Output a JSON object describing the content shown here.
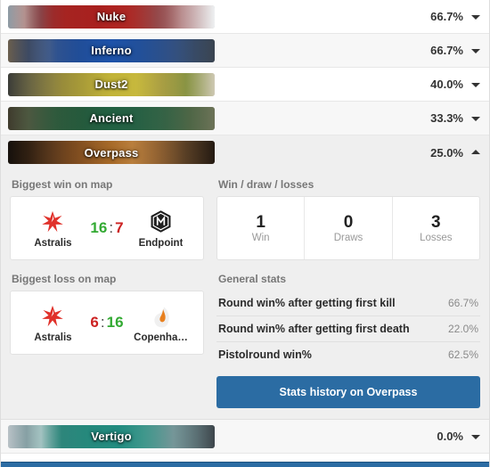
{
  "maps": [
    {
      "name": "Nuke",
      "win_pct": "66.7%",
      "expanded": false,
      "chevron": "chevron-down-icon",
      "theme": "nuke"
    },
    {
      "name": "Inferno",
      "win_pct": "66.7%",
      "expanded": false,
      "chevron": "chevron-down-icon",
      "theme": "inferno"
    },
    {
      "name": "Dust2",
      "win_pct": "40.0%",
      "expanded": false,
      "chevron": "chevron-down-icon",
      "theme": "dust2"
    },
    {
      "name": "Ancient",
      "win_pct": "33.3%",
      "expanded": false,
      "chevron": "chevron-down-icon",
      "theme": "ancient"
    },
    {
      "name": "Overpass",
      "win_pct": "25.0%",
      "expanded": true,
      "chevron": "chevron-up-icon",
      "theme": "overpass"
    },
    {
      "name": "Vertigo",
      "win_pct": "0.0%",
      "expanded": false,
      "chevron": "chevron-down-icon",
      "theme": "vertigo"
    }
  ],
  "detail": {
    "biggest_win": {
      "title": "Biggest win on map",
      "home_team": "Astralis",
      "home_logo": "astralis-star-logo",
      "away_team": "Endpoint",
      "away_logo": "endpoint-hexagon-logo",
      "home_score": "16",
      "away_score": "7",
      "separator": ":"
    },
    "biggest_loss": {
      "title": "Biggest loss on map",
      "home_team": "Astralis",
      "home_logo": "astralis-star-logo",
      "away_team": "Copenha…",
      "away_logo": "copenhagen-flames-logo",
      "home_score": "6",
      "away_score": "16",
      "separator": ":"
    },
    "wdl": {
      "title": "Win / draw / losses",
      "cells": [
        {
          "value": "1",
          "label": "Win"
        },
        {
          "value": "0",
          "label": "Draws"
        },
        {
          "value": "3",
          "label": "Losses"
        }
      ]
    },
    "general_stats": {
      "title": "General stats",
      "rows": [
        {
          "label": "Round win% after getting first kill",
          "value": "66.7%"
        },
        {
          "label": "Round win% after getting first death",
          "value": "22.0%"
        },
        {
          "label": "Pistolround win%",
          "value": "62.5%"
        }
      ]
    },
    "history_button": "Stats history on Overpass"
  },
  "colors": {
    "accent_blue": "#2b6ca3",
    "win_green": "#33aa33",
    "loss_red": "#cc2222",
    "panel_bg": "#efefef"
  }
}
